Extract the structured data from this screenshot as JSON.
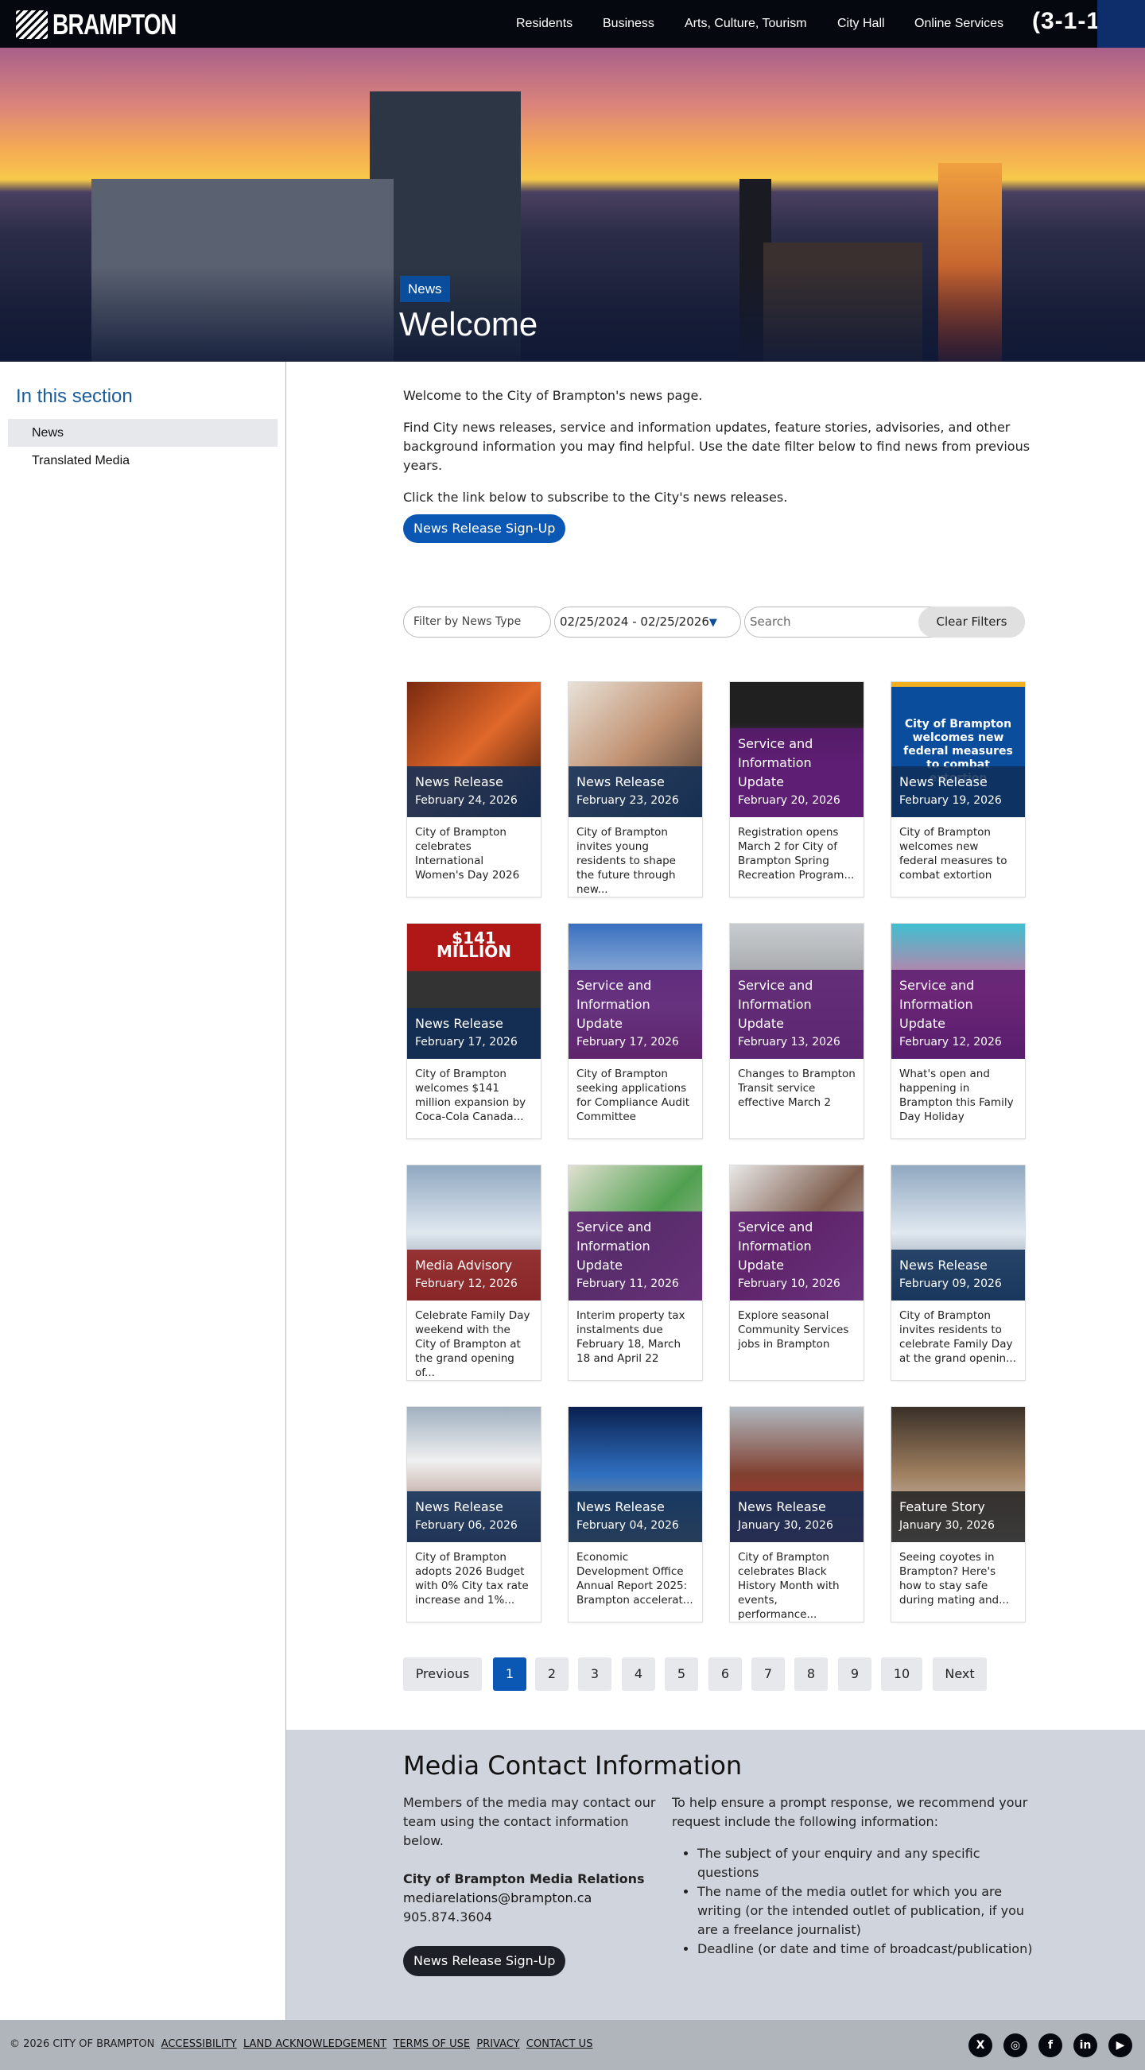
{
  "header": {
    "logo_text": "BRAMPTON",
    "nav": [
      "Residents",
      "Business",
      "Arts, Culture, Tourism",
      "City Hall",
      "Online Services"
    ],
    "phone_logo": "(3-1-1"
  },
  "hero": {
    "badge": "News",
    "title": "Welcome"
  },
  "sidebar": {
    "heading": "In this section",
    "items": [
      "News",
      "Translated Media"
    ]
  },
  "intro": {
    "p1": "Welcome to the City of Brampton's news page.",
    "p2": "Find City news releases, service and information updates, feature stories, advisories, and other background information you may find helpful. Use the date filter below to find news from previous years.",
    "p3": "Click the link below to subscribe to the City's news releases.",
    "signup": "News Release Sign-Up"
  },
  "filters": {
    "type_placeholder": "Filter by News Type",
    "date_range": "02/25/2024 - 02/25/2026",
    "search_placeholder": "Search",
    "clear": "Clear Filters"
  },
  "colors": {
    "news": "#0f2e58",
    "service": "#5a1a70",
    "advisory": "#8e1a1a",
    "feature": "#222222",
    "accent": "#0a58b4"
  },
  "cards": [
    {
      "type": "News Release",
      "date": "February 24, 2026",
      "title": "City of Brampton celebrates International Women's Day 2026",
      "kind": "news"
    },
    {
      "type": "News Release",
      "date": "February 23, 2026",
      "title": "City of Brampton invites young residents to shape the future through new...",
      "kind": "news"
    },
    {
      "type": "Service and Information Update",
      "date": "February 20, 2026",
      "title": "Registration opens March 2 for City of Brampton Spring Recreation Program...",
      "kind": "service"
    },
    {
      "type": "News Release",
      "date": "February 19, 2026",
      "title": "City of Brampton welcomes new federal measures to combat extortion",
      "kind": "news",
      "image_text": "City of Brampton welcomes new federal measures to combat extortion"
    },
    {
      "type": "News Release",
      "date": "February 17, 2026",
      "title": "City of Brampton welcomes $141 million expansion by Coca-Cola Canada...",
      "kind": "news",
      "image_text": "$141 MILLION"
    },
    {
      "type": "Service and Information Update",
      "date": "February 17, 2026",
      "title": "City of Brampton seeking applications for Compliance Audit Committee",
      "kind": "service"
    },
    {
      "type": "Service and Information Update",
      "date": "February 13, 2026",
      "title": "Changes to Brampton Transit service effective March 2",
      "kind": "service"
    },
    {
      "type": "Service and Information Update",
      "date": "February 12, 2026",
      "title": "What's open and happening in Brampton this Family Day Holiday",
      "kind": "service"
    },
    {
      "type": "Media Advisory",
      "date": "February 12, 2026",
      "title": "Celebrate Family Day weekend with the City of Brampton at the grand opening of...",
      "kind": "advisory"
    },
    {
      "type": "Service and Information Update",
      "date": "February 11, 2026",
      "title": "Interim property tax instalments due February 18, March 18 and April 22",
      "kind": "service"
    },
    {
      "type": "Service and Information Update",
      "date": "February 10, 2026",
      "title": "Explore seasonal Community Services jobs in Brampton",
      "kind": "service"
    },
    {
      "type": "News Release",
      "date": "February 09, 2026",
      "title": "City of Brampton invites residents to celebrate Family Day at the grand openin...",
      "kind": "news"
    },
    {
      "type": "News Release",
      "date": "February 06, 2026",
      "title": "City of Brampton adopts 2026 Budget with 0% City tax rate increase and 1%...",
      "kind": "news"
    },
    {
      "type": "News Release",
      "date": "February 04, 2026",
      "title": "Economic Development Office Annual Report 2025: Brampton accelerat...",
      "kind": "news"
    },
    {
      "type": "News Release",
      "date": "January 30, 2026",
      "title": "City of Brampton celebrates Black History Month with events, performance...",
      "kind": "news"
    },
    {
      "type": "Feature Story",
      "date": "January 30, 2026",
      "title": "Seeing coyotes in Brampton? Here's how to stay safe during mating and...",
      "kind": "feature"
    }
  ],
  "pagination": {
    "previous": "Previous",
    "pages": [
      "1",
      "2",
      "3",
      "4",
      "5",
      "6",
      "7",
      "8",
      "9",
      "10"
    ],
    "current": "1",
    "next": "Next"
  },
  "media": {
    "heading": "Media Contact Information",
    "left_text": "Members of the media may contact our team using the contact information below.",
    "org": "City of Brampton Media Relations",
    "email": "mediarelations@brampton.ca",
    "phone": "905.874.3604",
    "signup": "News Release Sign-Up",
    "right_text": "To help ensure a prompt response, we recommend your request include the following information:",
    "bullets": [
      "The subject of your enquiry and any specific questions",
      "The name of the media outlet for which you are writing (or the intended outlet of publication, if you are a freelance journalist)",
      "Deadline (or date and time of broadcast/publication)"
    ]
  },
  "footer": {
    "copyright": "© 2026 CITY OF BRAMPTON",
    "links": [
      "ACCESSIBILITY",
      "LAND ACKNOWLEDGEMENT",
      "TERMS OF USE",
      "PRIVACY",
      "CONTACT US"
    ],
    "social": [
      {
        "icon": "x-icon",
        "glyph": "X"
      },
      {
        "icon": "instagram-icon",
        "glyph": "◎"
      },
      {
        "icon": "facebook-icon",
        "glyph": "f"
      },
      {
        "icon": "linkedin-icon",
        "glyph": "in"
      },
      {
        "icon": "youtube-icon",
        "glyph": "▶"
      }
    ]
  }
}
